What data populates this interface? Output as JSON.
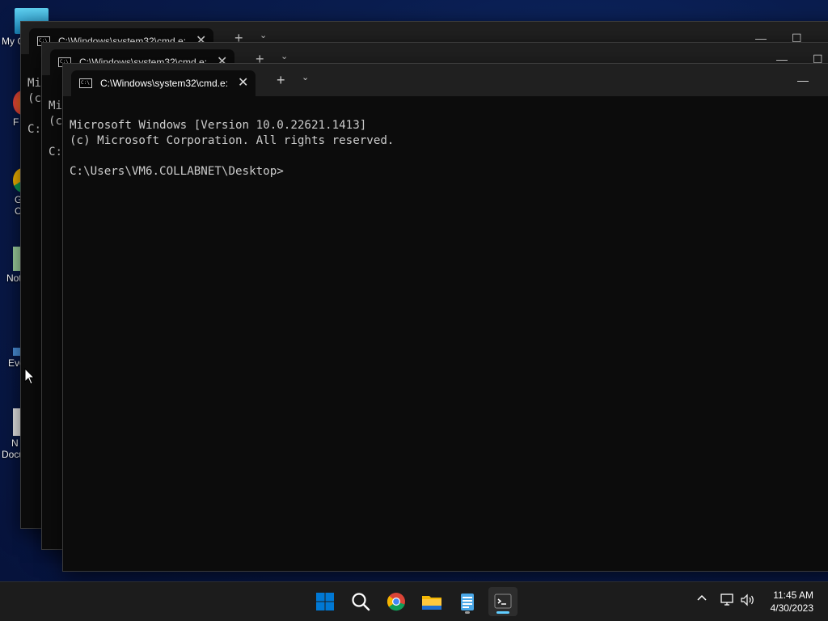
{
  "desktop": {
    "icons": [
      {
        "label": "My C",
        "icon": "this-pc-icon"
      },
      {
        "label": "F",
        "icon": "firefox-icon"
      },
      {
        "label": "G",
        "label2": "C",
        "icon": "chrome-icon"
      },
      {
        "label": "Not",
        "icon": "notepad-icon"
      },
      {
        "label": "Eve",
        "icon": "event-viewer-icon"
      },
      {
        "label": "N",
        "label2": "Docu",
        "icon": "document-icon"
      }
    ]
  },
  "windows": [
    {
      "tab_title": "C:\\Windows\\system32\\cmd.e:",
      "lines": [
        "Mi",
        "(c",
        "",
        "C:"
      ]
    },
    {
      "tab_title": "C:\\Windows\\system32\\cmd.e:",
      "lines": [
        "Mi",
        "(c",
        "",
        "C:"
      ]
    },
    {
      "tab_title": "C:\\Windows\\system32\\cmd.e:",
      "lines": [
        "Microsoft Windows [Version 10.0.22621.1413]",
        "(c) Microsoft Corporation. All rights reserved.",
        "",
        "C:\\Users\\VM6.COLLABNET\\Desktop>"
      ]
    }
  ],
  "taskbar": {
    "apps": [
      "start-icon",
      "search-icon",
      "chrome-icon",
      "file-explorer-icon",
      "notepad-icon",
      "terminal-icon"
    ],
    "clock_time": "11:45 AM",
    "clock_date": "4/30/2023",
    "colors": {
      "accent": "#0078d4",
      "indicator": "#60cdff"
    }
  }
}
